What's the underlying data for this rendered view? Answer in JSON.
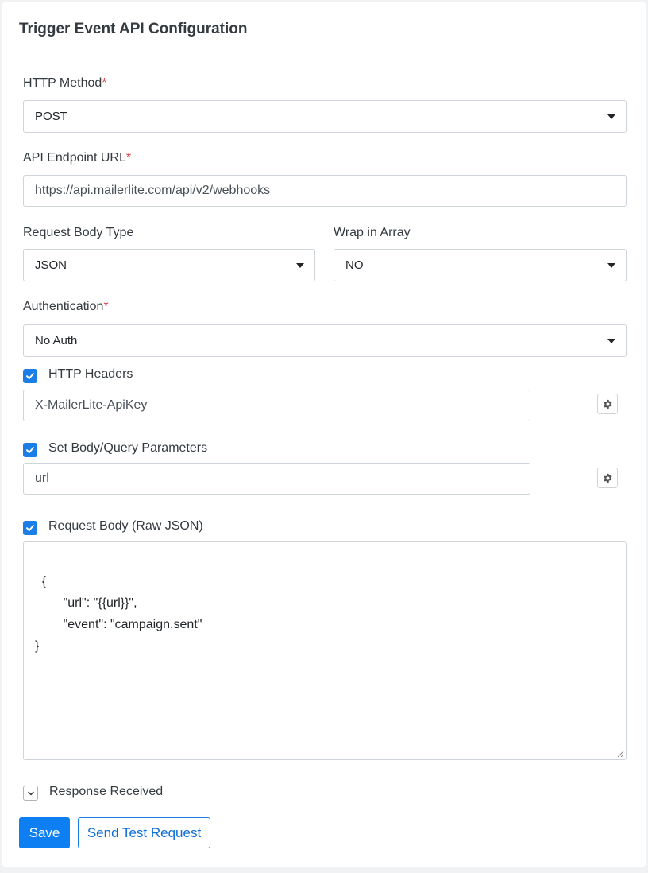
{
  "header": {
    "title": "Trigger Event API Configuration"
  },
  "fields": {
    "http_method": {
      "label": "HTTP Method",
      "required_mark": "*",
      "value": "POST"
    },
    "endpoint_url": {
      "label": "API Endpoint URL",
      "required_mark": "*",
      "value": "https://api.mailerlite.com/api/v2/webhooks"
    },
    "body_type": {
      "label": "Request Body Type",
      "value": "JSON"
    },
    "wrap_array": {
      "label": "Wrap in Array",
      "value": "NO"
    },
    "authentication": {
      "label": "Authentication",
      "required_mark": "*",
      "value": "No Auth"
    }
  },
  "http_headers": {
    "label": "HTTP Headers",
    "checked": true,
    "value": "X-MailerLite-ApiKey"
  },
  "body_params": {
    "label": "Set Body/Query Parameters",
    "checked": true,
    "value": "url"
  },
  "request_body": {
    "label": "Request Body (Raw JSON)",
    "checked": true,
    "value": "{\n        \"url\": \"{{url}}\",\n        \"event\": \"campaign.sent\"\n}"
  },
  "response": {
    "label": "Response Received",
    "expanded": false
  },
  "actions": {
    "save_label": "Save",
    "test_label": "Send Test Request"
  },
  "colors": {
    "primary": "#0d7ff2",
    "required": "#dc3545",
    "checkbox": "#1a7ee6"
  }
}
